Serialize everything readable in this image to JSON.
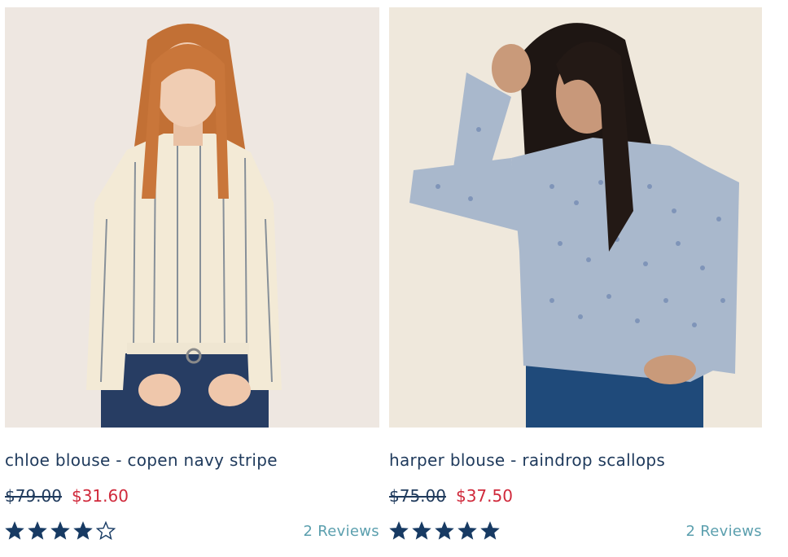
{
  "products": [
    {
      "name": "chloe blouse - copen navy stripe",
      "was_price": "$79.00",
      "sale_price": "$31.60",
      "rating": 4,
      "rating_max": 5,
      "reviews_label": "2 Reviews"
    },
    {
      "name": "harper blouse - raindrop scallops",
      "was_price": "$75.00",
      "sale_price": "$37.50",
      "rating": 5,
      "rating_max": 5,
      "reviews_label": "2 Reviews"
    }
  ],
  "colors": {
    "title": "#1f3a5c",
    "sale": "#d0293b",
    "star": "#173a63",
    "reviews": "#5b9fae"
  },
  "icons": {
    "star_filled": "star-filled-icon",
    "star_empty": "star-outline-icon"
  }
}
